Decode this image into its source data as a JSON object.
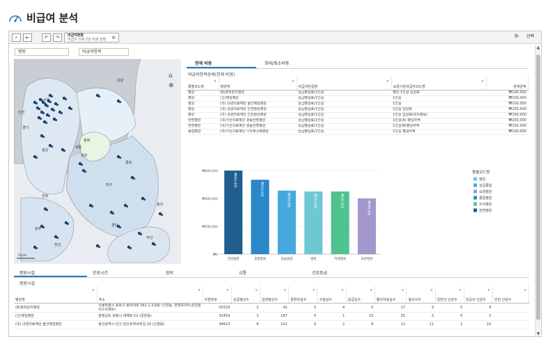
{
  "page": {
    "title": "비급여 분석"
  },
  "toolbar": {
    "sheet_tab_line1": "비급여현황",
    "sheet_tab_line2": "비급여 의료기관 비용 현황",
    "select_label": "선택"
  },
  "filters": {
    "hospital": "병원",
    "item": "비급여항목"
  },
  "top_tabs": [
    "현재 비용",
    "최대/최소비용"
  ],
  "table": {
    "subtitle": "비급여항목상세(현재 비용)",
    "headers": [
      "종별코드명",
      "병원명",
      "비급여한글명",
      "요양기관비급여코드명",
      "현재금액"
    ],
    "rows": [
      [
        "병원",
        "(B)본피킹지병원",
        "상급병실료/1인실",
        "병원 1인실 입원료",
        "₩100,000"
      ],
      [
        "병원",
        "(신)제일병원",
        "상급병실료/1인실",
        "1인실",
        "₩100,000"
      ],
      [
        "병원",
        "(의) 내경의료재단 울산제일병원",
        "상급병실료/1인실",
        "1인실",
        "₩100,000"
      ],
      [
        "병원",
        "(의) 성광의료재단 인천참튼병원",
        "상급병실료/1인실",
        "1인실 입원료",
        "₩150,000"
      ],
      [
        "병원",
        "(의) 성광의료재단 인천참튼병원",
        "상급병실료/1인실",
        "1인실 입원료(모유병용)",
        "₩190,000"
      ],
      [
        "한방병원",
        "(의)가산의료재단 광동한방병원",
        "상급병실료/1인실",
        "1인실(A) 병실차액",
        "₩200,000"
      ],
      [
        "한방병원",
        "(의)가산의료재단 광동한방병원",
        "상급병실료/1인실",
        "1인실(B)병실차액",
        "₩150,000"
      ],
      [
        "종합병원",
        "(의)가산의료재단 나사렛국제병원",
        "상급병실료/1인실",
        "1인실 병실차액",
        "₩100,000"
      ]
    ]
  },
  "chart_data": {
    "type": "bar",
    "categories": [
      "한방병원",
      "종합병원",
      "상급종합",
      "병원",
      "치과병원",
      "요양병원"
    ],
    "values": [
      600000,
      534000,
      456000,
      450000,
      450000,
      400000
    ],
    "value_labels": [
      "₩600,000",
      "₩534,000",
      "₩456,000",
      "₩450,000",
      "₩450,000",
      "₩400,000"
    ],
    "colors": [
      "#1f5e8e",
      "#2a87c8",
      "#45a9de",
      "#6fc7d3",
      "#4fc290",
      "#a497cd"
    ],
    "ylim": [
      0,
      600000
    ],
    "yticks": [
      0,
      200000,
      400000,
      600000
    ],
    "ytick_labels": [
      "₩0",
      "₩200,000",
      "₩400,000",
      "₩600,000"
    ],
    "legend": {
      "title": "종별코드명",
      "position": "right",
      "items": [
        {
          "label": "병원",
          "color": "#6fc7d3"
        },
        {
          "label": "상급종합",
          "color": "#45a9de"
        },
        {
          "label": "요양병원",
          "color": "#a497cd"
        },
        {
          "label": "종합병원",
          "color": "#2a87c8"
        },
        {
          "label": "치과병원",
          "color": "#4fc290"
        },
        {
          "label": "한방병원",
          "color": "#1f5e8e"
        }
      ]
    }
  },
  "map": {
    "labels": [
      "강원",
      "경기",
      "서울",
      "인천",
      "충북",
      "충남",
      "대전",
      "세종",
      "경북",
      "대구",
      "전북",
      "광주",
      "전남",
      "울산",
      "부산",
      "경남"
    ],
    "scale": "50 km"
  },
  "bottom": {
    "tabs": [
      "병원시설",
      "진료시간",
      "장비",
      "교통",
      "간호등급"
    ],
    "subtitle": "병원시설",
    "headers": [
      "병원명",
      "주소",
      "우편번호",
      "상급병상수",
      "일반병상수",
      "중환자실수",
      "수술실수",
      "응급실수",
      "물리치료실수",
      "총의사수",
      "일반의 인원수",
      "전공의 인원수",
      "인턴 인원수"
    ],
    "rows": [
      [
        "(B)본피킹지병원",
        "서울특별시 송파구 송파대로 562 2,3,8층 (신천동, 한빛프라자,삼성빌리스아파트)",
        "05518",
        "2",
        "42",
        "0",
        "4",
        "0",
        "17",
        "9",
        "0",
        "9",
        ""
      ],
      [
        "(신)제일병원",
        "충청남도 보령시 대해로 52 (궁촌동)",
        "33459",
        "3",
        "187",
        "0",
        "1",
        "15",
        "25",
        "5",
        "0",
        "5",
        ""
      ],
      [
        "(의) 내경의료재단 울산제일병원",
        "울산광역시 남구 삼산로354번길 26 (신정동)",
        "44623",
        "8",
        "141",
        "0",
        "2",
        "6",
        "11",
        "11",
        "1",
        "10",
        ""
      ]
    ]
  }
}
